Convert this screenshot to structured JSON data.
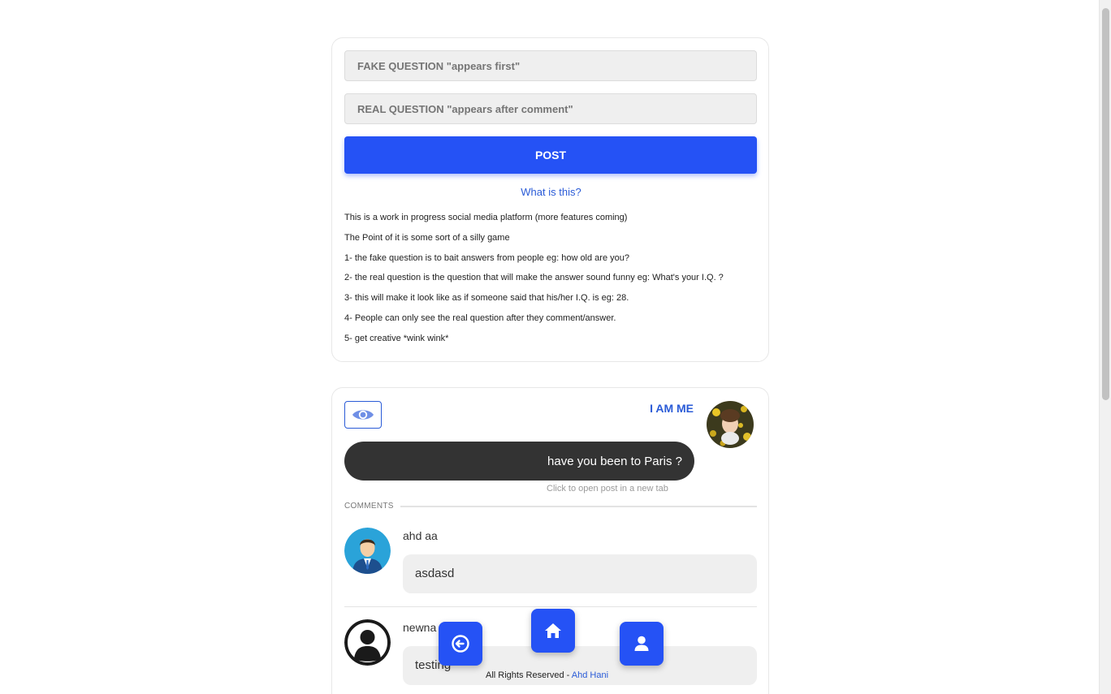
{
  "composer": {
    "fake_placeholder": "FAKE QUESTION \"appears first\"",
    "real_placeholder": "REAL QUESTION \"appears after comment\"",
    "post_label": "POST",
    "what_link": "What is this?",
    "info_lines": [
      "This is a work in progress social media platform (more features coming)",
      "The Point of it is some sort of a silly game",
      "1- the fake question is to bait answers from people eg: how old are you?",
      "2- the real question is the question that will make the answer sound funny eg: What's your I.Q. ?",
      "3- this will make it look like as if someone said that his/her I.Q. is eg: 28.",
      "4- People can only see the real question after they comment/answer.",
      "5- get creative *wink wink*"
    ]
  },
  "post": {
    "author": "I AM ME",
    "question": "have you been to Paris ?",
    "open_hint": "Click to open post in a new tab",
    "comments_label": "COMMENTS",
    "comments": [
      {
        "name": "ahd aa",
        "text": "asdasd"
      },
      {
        "name": "newna",
        "text": "testing"
      }
    ]
  },
  "nav": {
    "logout_icon": "sign-out-icon",
    "home_icon": "home-icon",
    "profile_icon": "user-icon"
  },
  "footer": {
    "text": "All Rights Reserved - ",
    "author_link": "Ahd Hani"
  },
  "colors": {
    "accent": "#2552f5",
    "link": "#2a5bd7",
    "bubble": "#333333"
  }
}
